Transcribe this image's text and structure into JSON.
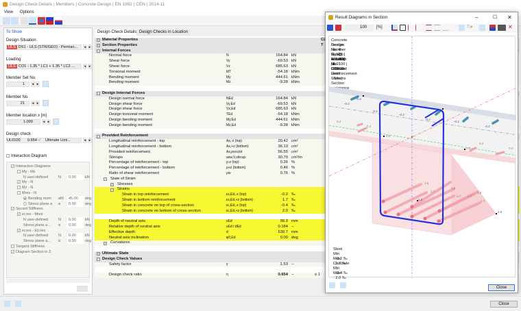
{
  "window": {
    "title": "Design Check Details | Members | Concrete Design | EN 1992 | CEN | 2014-11"
  },
  "menu": [
    "View",
    "Options"
  ],
  "left": {
    "to_show": "To Show",
    "design_situation_label": "Design Situation",
    "design_situation_badge": "ULS",
    "design_situation_value": "DS1 - ULS (STR/GEO) - Perman...",
    "loading_label": "Loading",
    "loading_badge": "ULS",
    "loading_value": "CO1 - 1.35 * LC1 + 1.35 * LC2 ...",
    "member_set_label": "Member Set No.",
    "member_set_value": "1",
    "member_label": "Member No.",
    "member_value": "21",
    "location_label": "Member location x [m]",
    "location_value": "1.000",
    "design_check_label": "Design check",
    "design_check_id": "UL0100",
    "design_check_ratio": "0.654",
    "design_check_type": "Ultimate Limi...",
    "interaction_label": "Interaction Diagram",
    "tree": [
      {
        "level": 0,
        "check": "✓",
        "label": "Interaction Diagrams",
        "sym": "",
        "val": "",
        "unit": ""
      },
      {
        "level": 1,
        "check": "",
        "label": "My - Mz",
        "sym": "",
        "val": "",
        "unit": ""
      },
      {
        "level": 2,
        "check": null,
        "label": "N user-defined",
        "sym": "N",
        "val": "0.00",
        "unit": "kN"
      },
      {
        "level": 1,
        "check": "✓",
        "label": "My - N",
        "sym": "",
        "val": "",
        "unit": ""
      },
      {
        "level": 1,
        "check": "",
        "label": "Mz - N",
        "sym": "",
        "val": "",
        "unit": ""
      },
      {
        "level": 1,
        "check": "",
        "label": "Mres - N",
        "sym": "",
        "val": "",
        "unit": ""
      },
      {
        "level": 2,
        "check": "●",
        "label": "Bending mom",
        "sym": "αM",
        "val": "45.00",
        "unit": "deg"
      },
      {
        "level": 2,
        "check": "○",
        "label": "Stress plane a",
        "sym": "α",
        "val": "0.00",
        "unit": "deg"
      },
      {
        "level": 0,
        "check": "✓",
        "label": "Secant Stiffness",
        "sym": "",
        "val": "",
        "unit": ""
      },
      {
        "level": 1,
        "check": "✓",
        "label": "κr,res - Mres",
        "sym": "",
        "val": "",
        "unit": ""
      },
      {
        "level": 2,
        "check": null,
        "label": "N user-defined",
        "sym": "N",
        "val": "0.00",
        "unit": "kN"
      },
      {
        "level": 2,
        "check": null,
        "label": "Stress plane a...",
        "sym": "α",
        "val": "0.00",
        "unit": "deg"
      },
      {
        "level": 1,
        "check": "✓",
        "label": "κr,res - EIr,res",
        "sym": "",
        "val": "",
        "unit": ""
      },
      {
        "level": 2,
        "check": null,
        "label": "N user-defined",
        "sym": "N",
        "val": "0.00",
        "unit": "kN"
      },
      {
        "level": 2,
        "check": null,
        "label": "Stress plane a...",
        "sym": "α",
        "val": "0.00",
        "unit": "deg"
      },
      {
        "level": 0,
        "check": "",
        "label": "Tangent Stiffness",
        "sym": "",
        "val": "",
        "unit": ""
      },
      {
        "level": 0,
        "check": "✓",
        "label": "Diagram Section in 3",
        "sym": "",
        "val": "",
        "unit": ""
      }
    ]
  },
  "tabs": [
    "Design Check Details",
    "Design Checks in Location"
  ],
  "table": [
    {
      "t": "group",
      "pm": "+",
      "label": "Material Properties",
      "c2": "C25/30"
    },
    {
      "t": "group",
      "pm": "+",
      "label": "Section Properties",
      "c2": "T"
    },
    {
      "t": "group",
      "pm": "−",
      "label": "Internal Forces"
    },
    {
      "t": "item",
      "lv": 1,
      "label": "Normal force",
      "sym": "N",
      "val": "164.84",
      "unit": "kN"
    },
    {
      "t": "item",
      "lv": 1,
      "label": "Shear force",
      "sym": "Vy",
      "val": "-69.53",
      "unit": "kN"
    },
    {
      "t": "item",
      "lv": 1,
      "label": "Shear force",
      "sym": "Vz",
      "val": "685.63",
      "unit": "kN"
    },
    {
      "t": "item",
      "lv": 1,
      "label": "Torsional moment",
      "sym": "MT",
      "val": "-54.18",
      "unit": "kNm"
    },
    {
      "t": "item",
      "lv": 1,
      "label": "Bending moment",
      "sym": "My",
      "val": "444.61",
      "unit": "kNm"
    },
    {
      "t": "item",
      "lv": 1,
      "label": "Bending moment",
      "sym": "Mz",
      "val": "-9.28",
      "unit": "kNm"
    },
    {
      "t": "blank"
    },
    {
      "t": "group",
      "pm": "−",
      "label": "Design Internal Forces"
    },
    {
      "t": "item",
      "lv": 1,
      "label": "Design normal force",
      "sym": "NEd",
      "val": "164.84",
      "unit": "kN"
    },
    {
      "t": "item",
      "lv": 1,
      "label": "Design shear force",
      "sym": "Vy,Ed",
      "val": "-69.53",
      "unit": "kN"
    },
    {
      "t": "item",
      "lv": 1,
      "label": "Design shear force",
      "sym": "Vz,Ed",
      "val": "685.63",
      "unit": "kN"
    },
    {
      "t": "item",
      "lv": 1,
      "label": "Design torsional moment",
      "sym": "TEd",
      "val": "-54.18",
      "unit": "kNm"
    },
    {
      "t": "item",
      "lv": 1,
      "label": "Design bending moment",
      "sym": "My,Ed",
      "val": "444.61",
      "unit": "kNm"
    },
    {
      "t": "item",
      "lv": 1,
      "label": "Design bending moment",
      "sym": "Mz,Ed",
      "val": "-9.28",
      "unit": "kNm"
    },
    {
      "t": "blank"
    },
    {
      "t": "group",
      "pm": "−",
      "label": "Provided Reinforcement"
    },
    {
      "t": "item",
      "lv": 1,
      "label": "Longitudinal reinforcement - top",
      "sym": "As,-z (top)",
      "val": "20.42",
      "unit": "cm²"
    },
    {
      "t": "item",
      "lv": 1,
      "label": "Longitudinal reinforcement - bottom",
      "sym": "As,+z (bottom)",
      "val": "36.13",
      "unit": "cm²"
    },
    {
      "t": "item",
      "lv": 1,
      "label": "Provided reinforcement",
      "sym": "As,prov,tot",
      "val": "56.55",
      "unit": "cm²"
    },
    {
      "t": "item",
      "lv": 1,
      "label": "Stirrups",
      "sym": "asw,V,stirrup",
      "val": "30.79",
      "unit": "cm²/m"
    },
    {
      "t": "item",
      "lv": 1,
      "label": "Percentage of reinforcement - top",
      "sym": "ρ-z (top)",
      "val": "0.26",
      "unit": "%"
    },
    {
      "t": "item",
      "lv": 1,
      "label": "Percentage of reinforcement - bottom",
      "sym": "ρ+z (bottom)",
      "val": "0.46",
      "unit": "%"
    },
    {
      "t": "item",
      "lv": 1,
      "label": "Ratio of shear reinforcement",
      "sym": "ρw",
      "val": "0.76",
      "unit": "%"
    },
    {
      "t": "sub",
      "lv": 1,
      "pm": "−",
      "label": "State of Strain"
    },
    {
      "t": "sub",
      "lv": 2,
      "pm": "+",
      "label": "Stresses"
    },
    {
      "t": "sub",
      "lv": 2,
      "pm": "−",
      "label": "Strains",
      "hl": true
    },
    {
      "t": "item",
      "lv": 3,
      "hl": true,
      "label": "Strain in top reinforcement",
      "sym": "εs,Ed,-z (top)",
      "val": "-0.2",
      "unit": "‰"
    },
    {
      "t": "item",
      "lv": 3,
      "hl": true,
      "label": "Strain in bottom reinforcement",
      "sym": "εs,Ed,+z (bottom)",
      "val": "1.7",
      "unit": "‰"
    },
    {
      "t": "item",
      "lv": 3,
      "hl": true,
      "label": "Strain in concrete on top of cross-section",
      "sym": "εc,Ed,-z (top)",
      "val": "-0.4",
      "unit": "‰"
    },
    {
      "t": "item",
      "lv": 3,
      "hl": true,
      "label": "Strain in concrete on bottom of cross-section",
      "sym": "εc,Ed,+z (bottom)",
      "val": "2.0",
      "unit": "‰"
    },
    {
      "t": "blank",
      "hl": true
    },
    {
      "t": "item",
      "lv": 1,
      "hl": true,
      "label": "Depth of neutral axis",
      "sym": "xEd",
      "val": "99.3",
      "unit": "mm"
    },
    {
      "t": "item",
      "lv": 1,
      "hl": true,
      "label": "Relative depth of neutral axis",
      "sym": "xEd / dEd",
      "val": "0.184",
      "unit": "--"
    },
    {
      "t": "item",
      "lv": 1,
      "hl": true,
      "label": "Effective depth",
      "sym": "d",
      "val": "539.7",
      "unit": "mm"
    },
    {
      "t": "item",
      "lv": 1,
      "hl": true,
      "label": "Neutral axis inclination",
      "sym": "φ0,Ed",
      "val": "0.00",
      "unit": "deg"
    },
    {
      "t": "sub",
      "lv": 1,
      "pm": "+",
      "label": "Curvatures"
    },
    {
      "t": "blank"
    },
    {
      "t": "group",
      "pm": "+",
      "label": "Ultimate State"
    },
    {
      "t": "group",
      "pm": "−",
      "label": "Design Check Values"
    },
    {
      "t": "item",
      "lv": 1,
      "label": "Safety factor",
      "sym": "γ",
      "val": "1.53",
      "unit": "--"
    },
    {
      "t": "blank"
    },
    {
      "t": "item",
      "lv": 1,
      "label": "Design check ratio",
      "sym": "η",
      "val": "0.654",
      "unit": "--",
      "ext": "≤ 1",
      "bold": true
    }
  ],
  "dialog": {
    "title": "Result Diagrams in Section",
    "zoom": "100",
    "zoom_unit": "[%]",
    "info": [
      "Concrete Design",
      "Section No. 4 - R_M1 400/400 | 1 - C25/30",
      "Member No. 21 | x: 1.000 m",
      "Design Situation No. 1",
      "Loading No. CO1",
      "UL0100 | Ultimate Limit State | Section resistance acc. to 6.1",
      "Provided Reinforcement - Strains"
    ],
    "legend": [
      {
        "h": "Steel"
      },
      {
        "k": "Min",
        "v": ": -0.2 ‰"
      },
      {
        "k": "Max",
        "v": ":  1.7 ‰"
      },
      {
        "h": "Concrete"
      },
      {
        "k": "Min",
        "v": ": -0.4 ‰"
      },
      {
        "k": "Max",
        "v": ":  2.0 ‰"
      }
    ],
    "labels": {
      "top_bar": "-0.2",
      "slab_top": "-0.4",
      "slab_bot": "0.4",
      "na_left": "0.5",
      "na_right": "0.5",
      "b1": "1.6",
      "b2": "1.7",
      "b3": "1.6",
      "b4": "1.7",
      "b5": "1.6",
      "b6": "1.7",
      "b7": "1.7",
      "c_max": "2.0",
      "c_max2": "2.0"
    },
    "close": "Close"
  },
  "footer": {
    "close": "Close"
  },
  "colors": {
    "stirrup": "#2233dd",
    "highlight": "#f6f631",
    "uls": "#d9534f"
  }
}
